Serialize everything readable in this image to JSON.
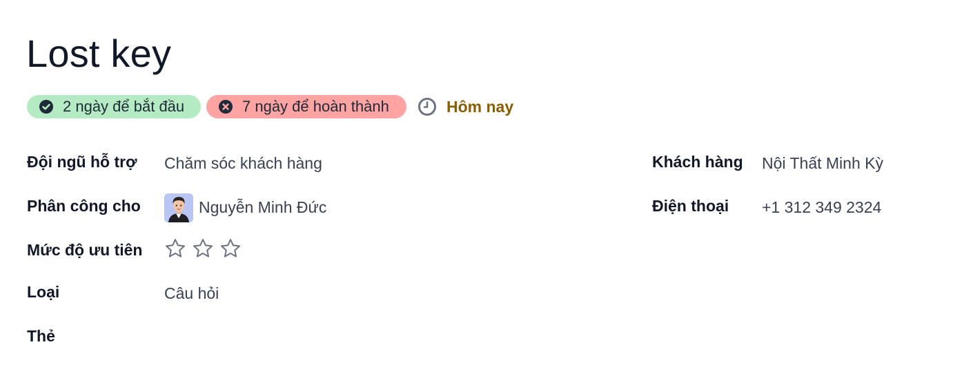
{
  "ticket": {
    "title": "Lost key"
  },
  "badges": {
    "start": {
      "label": "2 ngày để bắt đầu",
      "color": "#b4ebc2"
    },
    "finish": {
      "label": "7 ngày để hoàn thành",
      "color": "#ffa3a3"
    },
    "deadline": {
      "label": "Hôm nay",
      "color": "#8a5d00"
    }
  },
  "fields": {
    "team": {
      "label": "Đội ngũ hỗ trợ",
      "value": "Chăm sóc khách hàng"
    },
    "assignee": {
      "label": "Phân công cho",
      "value": "Nguyễn Minh Đức"
    },
    "priority": {
      "label": "Mức độ ưu tiên",
      "stars_total": 3,
      "stars_filled": 0
    },
    "type": {
      "label": "Loại",
      "value": "Câu hỏi"
    },
    "tags": {
      "label": "Thẻ",
      "value": ""
    },
    "customer": {
      "label": "Khách hàng",
      "value": "Nội Thất Minh Kỳ"
    },
    "phone": {
      "label": "Điện thoại",
      "value": "+1 312 349 2324"
    }
  },
  "icons": {
    "start": "check-circle-icon",
    "finish": "x-circle-icon",
    "deadline": "clock-icon",
    "priority": "star-outline-icon"
  }
}
